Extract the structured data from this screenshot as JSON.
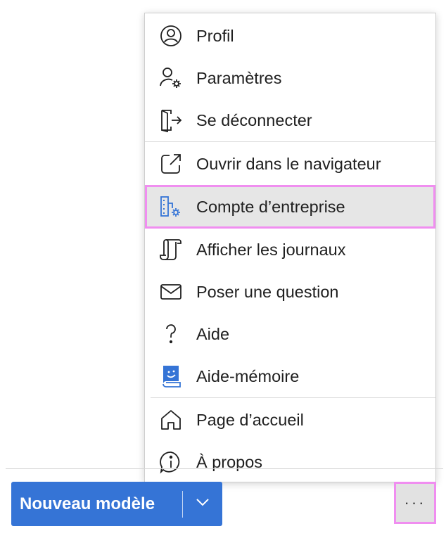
{
  "menu": {
    "items": [
      {
        "label": "Profil",
        "icon": "profile-icon"
      },
      {
        "label": "Paramètres",
        "icon": "settings-person-icon"
      },
      {
        "label": "Se déconnecter",
        "icon": "sign-out-icon"
      },
      {
        "label": "Ouvrir dans le navigateur",
        "icon": "open-external-icon"
      },
      {
        "label": "Compte d’entreprise",
        "icon": "organization-settings-icon",
        "selected": true
      },
      {
        "label": "Afficher les journaux",
        "icon": "scroll-logs-icon"
      },
      {
        "label": "Poser une question",
        "icon": "mail-icon"
      },
      {
        "label": "Aide",
        "icon": "question-icon"
      },
      {
        "label": "Aide-mémoire",
        "icon": "cheat-sheet-icon"
      },
      {
        "label": "Page d’accueil",
        "icon": "home-icon"
      },
      {
        "label": "À propos",
        "icon": "info-icon"
      }
    ]
  },
  "footer": {
    "new_model_label": "Nouveau modèle",
    "dropdown_icon": "chevron-down-icon",
    "more_label": "···"
  },
  "colors": {
    "accent": "#3574d6",
    "highlight_border": "#f08ef0",
    "selected_bg": "#e6e6e6"
  }
}
